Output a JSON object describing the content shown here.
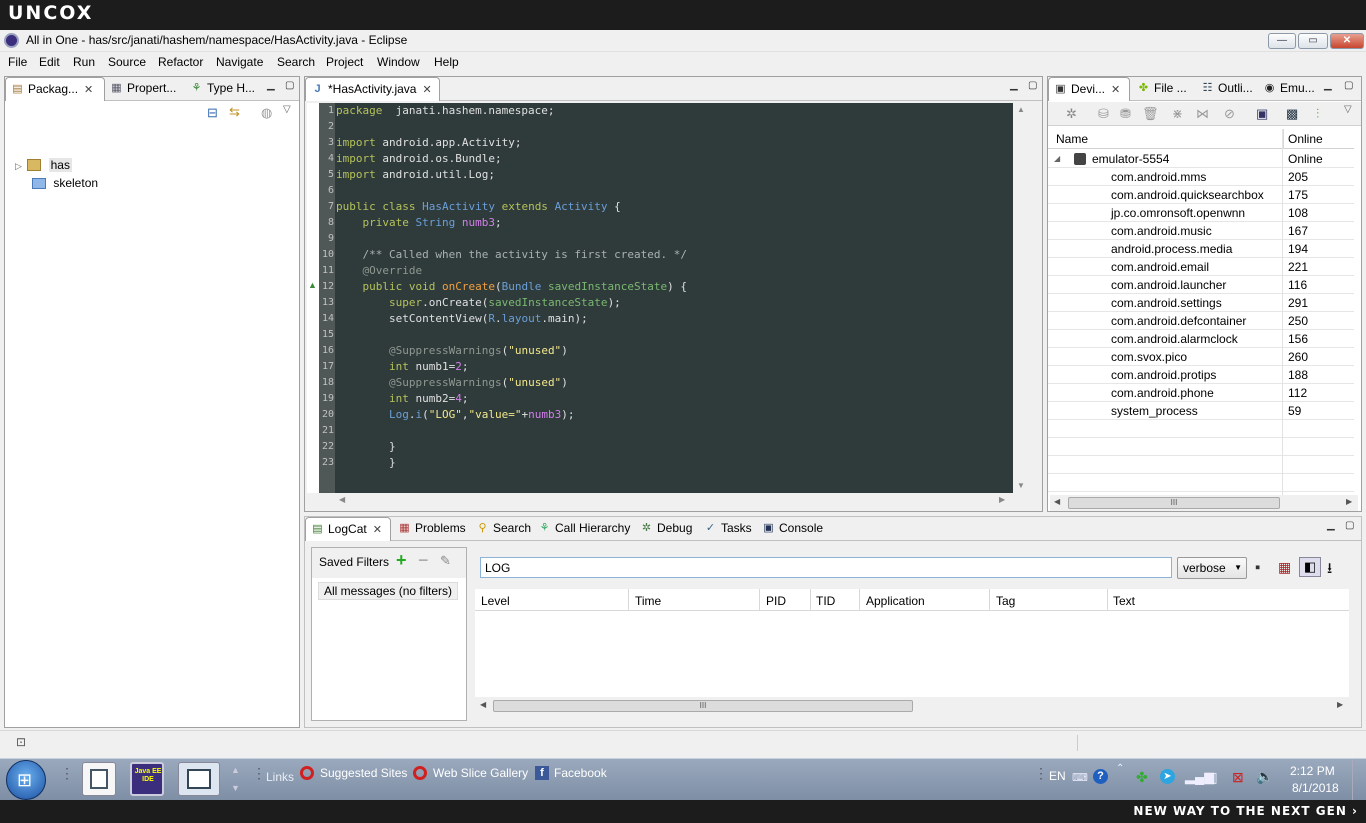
{
  "brand": {
    "logo": "UNCOX",
    "tagline": "NEW WAY TO THE NEXT GEN ›"
  },
  "window": {
    "title": "All in One - has/src/janati/hashem/namespace/HasActivity.java - Eclipse",
    "min": "—",
    "max": "▭",
    "close": "✕"
  },
  "menu": [
    "File",
    "Edit",
    "Run",
    "Source",
    "Refactor",
    "Navigate",
    "Search",
    "Project",
    "Window",
    "Help"
  ],
  "left_panel": {
    "tabs": [
      {
        "label": "Packag...",
        "icon": "package-icon"
      },
      {
        "label": "Propert...",
        "icon": "properties-icon"
      },
      {
        "label": "Type H...",
        "icon": "hierarchy-icon"
      }
    ],
    "tree": [
      {
        "label": "has",
        "icon": "project-icon"
      },
      {
        "label": "skeleton",
        "icon": "folder-icon"
      }
    ]
  },
  "editor": {
    "tab_label": "*HasActivity.java",
    "line_numbers": [
      "1",
      "2",
      "3",
      "4",
      "5",
      "6",
      "7",
      "8",
      "9",
      "10",
      "11",
      "12",
      "13",
      "14",
      "15",
      "16",
      "17",
      "18",
      "19",
      "20",
      "21",
      "22",
      "23"
    ]
  },
  "devices_panel": {
    "tabs": [
      {
        "label": "Devi...",
        "icon": "device-icon"
      },
      {
        "label": "File ...",
        "icon": "android-icon"
      },
      {
        "label": "Outli...",
        "icon": "outline-icon"
      },
      {
        "label": "Emu...",
        "icon": "emulator-icon"
      }
    ],
    "columns": [
      "Name",
      "Online"
    ],
    "device": {
      "name": "emulator-5554",
      "status": "Online"
    },
    "processes": [
      {
        "name": "com.android.mms",
        "pid": "205"
      },
      {
        "name": "com.android.quicksearchbox",
        "pid": "175"
      },
      {
        "name": "jp.co.omronsoft.openwnn",
        "pid": "108"
      },
      {
        "name": "com.android.music",
        "pid": "167"
      },
      {
        "name": "android.process.media",
        "pid": "194"
      },
      {
        "name": "com.android.email",
        "pid": "221"
      },
      {
        "name": "com.android.launcher",
        "pid": "116"
      },
      {
        "name": "com.android.settings",
        "pid": "291"
      },
      {
        "name": "com.android.defcontainer",
        "pid": "250"
      },
      {
        "name": "com.android.alarmclock",
        "pid": "156"
      },
      {
        "name": "com.svox.pico",
        "pid": "260"
      },
      {
        "name": "com.android.protips",
        "pid": "188"
      },
      {
        "name": "com.android.phone",
        "pid": "112"
      },
      {
        "name": "system_process",
        "pid": "59"
      }
    ],
    "scroll_grip": "III"
  },
  "bottom_panel": {
    "tabs": [
      {
        "label": "LogCat",
        "icon": "logcat-icon"
      },
      {
        "label": "Problems",
        "icon": "problems-icon"
      },
      {
        "label": "Search",
        "icon": "search-icon"
      },
      {
        "label": "Call Hierarchy",
        "icon": "call-hierarchy-icon"
      },
      {
        "label": "Debug",
        "icon": "bug-icon"
      },
      {
        "label": "Tasks",
        "icon": "tasks-icon"
      },
      {
        "label": "Console",
        "icon": "console-icon"
      }
    ],
    "saved_filters_label": "Saved Filters",
    "all_messages": "All messages (no filters)",
    "search_value": "LOG",
    "level_select": "verbose",
    "columns": [
      "Level",
      "Time",
      "PID",
      "TID",
      "Application",
      "Tag",
      "Text"
    ],
    "scroll_grip": "III"
  },
  "taskbar": {
    "links_label": "Links",
    "links": [
      "Suggested Sites",
      "Web Slice Gallery",
      "Facebook"
    ],
    "lang": "EN",
    "time": "2:12 PM",
    "date": "8/1/2018",
    "java_ee_label": "Java EE IDE"
  },
  "colors": {
    "editor_bg": "#2f3a3b",
    "keyword": "#b4c25c",
    "type": "#6a9fd8",
    "string": "#f2e88c",
    "accent": "#0066cc"
  }
}
